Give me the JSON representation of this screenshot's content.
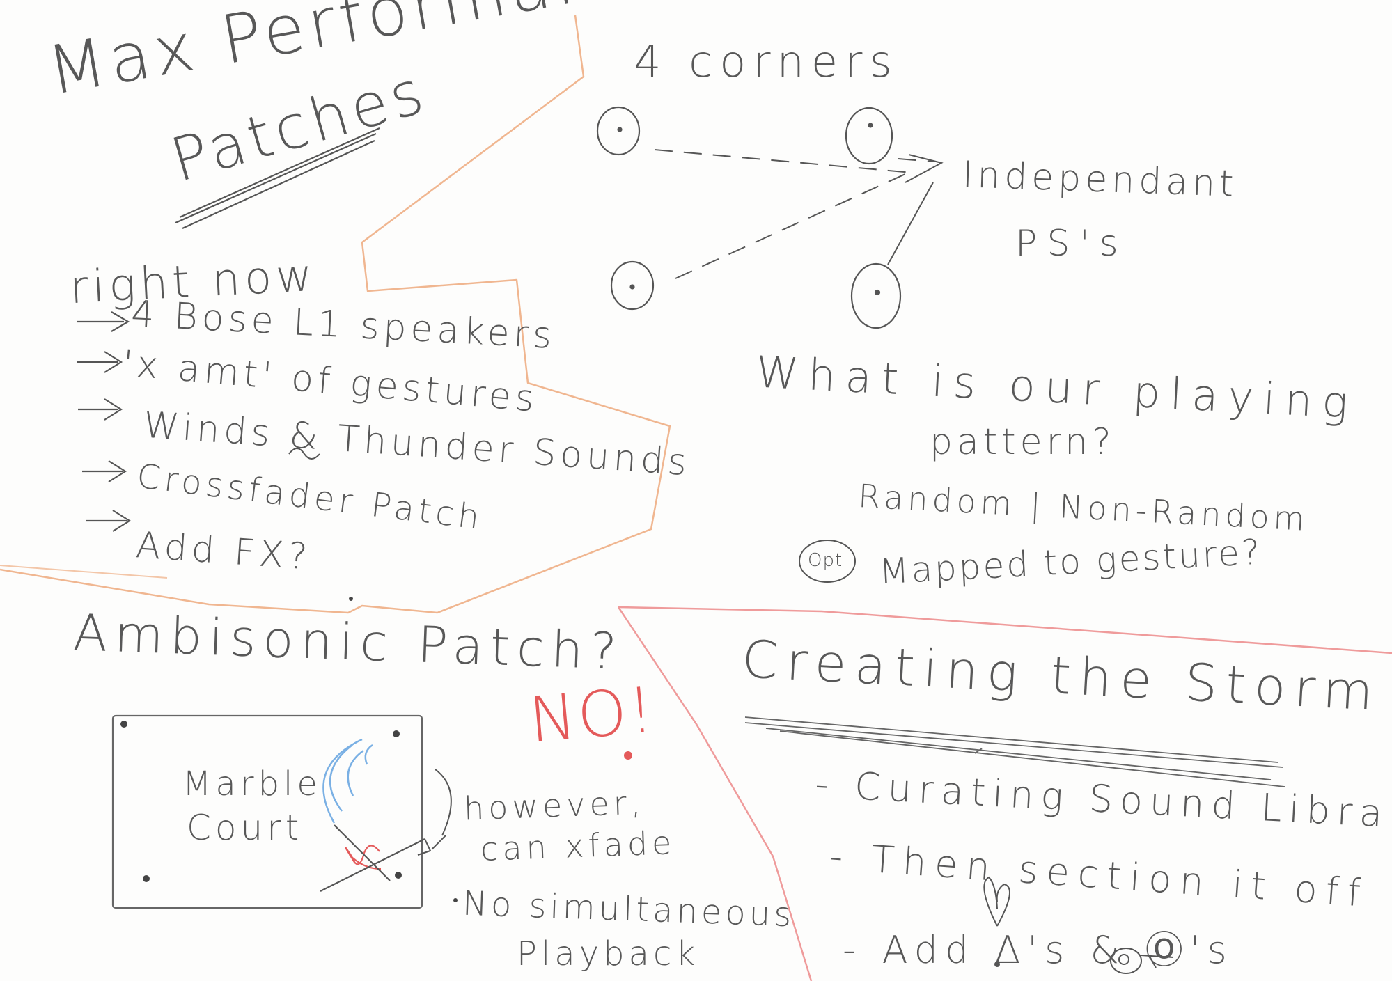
{
  "colors": {
    "pencil": "#585858",
    "orange": "#f0b690",
    "red": "#e45a5a",
    "blue": "#7ab0e4"
  },
  "header": {
    "title_line1": "Max Performance",
    "title_line2": "Patches"
  },
  "right_now": {
    "heading": "right now",
    "items": [
      "4 Bose L1 speakers",
      "'x amt' of gestures",
      "Winds & Thunder Sounds",
      "Crossfader Patch",
      "Add FX?"
    ]
  },
  "corners": {
    "heading": "4 corners",
    "label_line1": "Independant",
    "label_line2": "PS's"
  },
  "playing": {
    "question_line1": "What is our playing",
    "question_line2": "pattern?",
    "random": "Random | Non-Random",
    "opt_badge": "Opt",
    "mapped": "Mapped to gesture?"
  },
  "ambisonic": {
    "heading": "Ambisonic Patch?",
    "no": "NO!",
    "box_line1": "Marble",
    "box_line2": "Court",
    "however_line1": "however,",
    "however_line2": "can xfade",
    "note_line1": "No simultaneous",
    "note_line2": "Playback"
  },
  "storm": {
    "heading": "Creating the Storm",
    "item1": "- Curating Sound Library",
    "item2": "- Then section it off",
    "item3": "- Add Δ's & Ⓞ's"
  }
}
